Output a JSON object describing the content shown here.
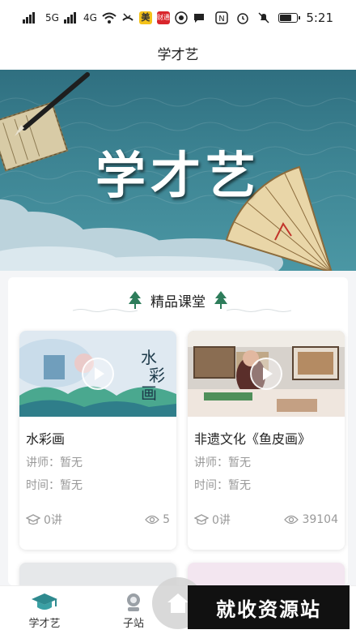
{
  "status_bar": {
    "left_signal_1": "5G",
    "left_signal_2": "4G",
    "badge_mei": "美",
    "badge_red": "财通",
    "time": "5:21"
  },
  "header": {
    "title": "学才艺"
  },
  "banner": {
    "title": "学才艺"
  },
  "section": {
    "title": "精品课堂"
  },
  "courses": [
    {
      "title": "水彩画",
      "lecturer": "讲师：暂无",
      "time": "时间：暂无",
      "lessons": "0讲",
      "views": "5"
    },
    {
      "title": "非遗文化《鱼皮画》",
      "lecturer": "讲师：暂无",
      "time": "时间：暂无",
      "lessons": "0讲",
      "views": "39104"
    }
  ],
  "bottom_nav": {
    "items": [
      {
        "label": "学才艺"
      },
      {
        "label": "子站"
      }
    ]
  },
  "watermark": "就收资源站",
  "colors": {
    "banner_teal": "#3d8493",
    "accent_green": "#2e7d5b",
    "text_gray": "#999999"
  }
}
